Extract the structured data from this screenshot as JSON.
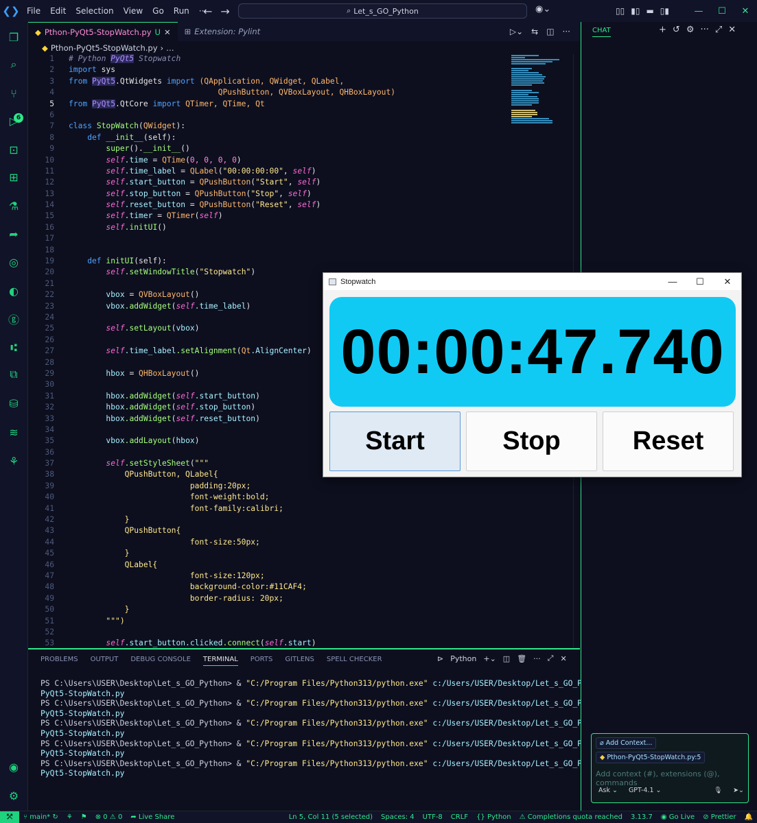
{
  "titlebar": {
    "menu": [
      "File",
      "Edit",
      "Selection",
      "View",
      "Go",
      "Run",
      "···"
    ],
    "search": "Let_s_GO_Python"
  },
  "scm_badge": "6",
  "tabs": [
    {
      "label": "Pthon-PyQt5-StopWatch.py",
      "flag": "U"
    },
    {
      "label": "Extension: Pylint"
    }
  ],
  "breadcrumb": {
    "file": "Pthon-PyQt5-StopWatch.py",
    "rest": "…"
  },
  "code_lines": [
    "1",
    "2",
    "3",
    "4",
    "5",
    "6",
    "7",
    "8",
    "9",
    "10",
    "11",
    "12",
    "13",
    "14",
    "15",
    "16",
    "17",
    "18",
    "19",
    "20",
    "21",
    "22",
    "23",
    "24",
    "25",
    "26",
    "27",
    "28",
    "29",
    "30",
    "31",
    "32",
    "33",
    "34",
    "35",
    "36",
    "37",
    "38",
    "39",
    "40",
    "41",
    "42",
    "43",
    "44",
    "45",
    "46",
    "47",
    "48",
    "49",
    "50",
    "51",
    "52",
    "53"
  ],
  "code": {
    "l1a": "# Python ",
    "l1b": "PyQt5",
    "l1c": " Stopwatch",
    "l2a": "import",
    "l2b": " sys",
    "l3a": "from ",
    "l3b": "PyQt5",
    "l3c": ".QtWidgets ",
    "l3d": "import ",
    "l3e": "(QApplication, QWidget, QLabel,",
    "l4": "                                QPushButton, QVBoxLayout, QHBoxLayout)",
    "l5a": "from ",
    "l5b": "PyQt5",
    "l5c": ".QtCore ",
    "l5d": "import ",
    "l5e": "QTimer, QTime, Qt",
    "l7a": "class ",
    "l7b": "StopWatch",
    "l7c": "(",
    "l7d": "QWidget",
    "l7e": "):",
    "l8a": "    def ",
    "l8b": "__init__",
    "l8c": "(self):",
    "l9a": "        super",
    "l9b": "().",
    "l9c": "__init__",
    "l9d": "()",
    "l10a": "self",
    ".l10b": "",
    "l10c": ".time = ",
    "l10d": "QTime",
    "l10e": "(",
    "l10f": "0, 0, 0, 0",
    "l10g": ")",
    "l11s": "\"00:00:00:00\"",
    "l12s": "\"Start\"",
    "l13s": "\"Stop\"",
    "l14s": "\"Reset\"",
    "l20s": "\"Stopwatch\"",
    "l37s": "\"\"\"",
    "l38": "QPushButton, QLabel{",
    "l39": "padding:20px;",
    "l40": "font-weight:bold;",
    "l41": "font-family:calibri;",
    "l42": "}",
    "l43": "QPushButton{",
    "l44": "font-size:50px;",
    "l45": "}",
    "l46": "QLabel{",
    "l47": "font-size:120px;",
    "l48": "background-color:#11CAF4;",
    "l49": "border-radius: 20px;",
    "l50": "}",
    "l51": "\"\"\")"
  },
  "panel": {
    "tabs": [
      "PROBLEMS",
      "OUTPUT",
      "DEBUG CONSOLE",
      "TERMINAL",
      "PORTS",
      "GITLENS",
      "SPELL CHECKER"
    ],
    "active_tab": "TERMINAL",
    "shell": "Python",
    "terminal_prompt": "PS C:\\Users\\USER\\Desktop\\Let_s_GO_Python> ",
    "terminal_cmd_amp": "& ",
    "terminal_exe": "\"C:/Program Files/Python313/python.exe\"",
    "terminal_arg": " c:/Users/USER/Desktop/Let_s_GO_Python/Pthon-",
    "terminal_wrap": "PyQt5-StopWatch.py"
  },
  "chat": {
    "title": "CHAT",
    "add_context": "Add Context...",
    "file_chip": "Pthon-PyQt5-StopWatch.py:5",
    "placeholder": "Add context (#), extensions (@), commands",
    "mode": "Ask",
    "model": "GPT-4.1"
  },
  "status": {
    "branch": "main*",
    "errors": "0",
    "warnings": "0",
    "live_share": "Live Share",
    "position": "Ln 5, Col 11 (5 selected)",
    "spaces": "Spaces: 4",
    "encoding": "UTF-8",
    "eol": "CRLF",
    "language": "Python",
    "quota": "Completions quota reached",
    "py_version": "3.13.7",
    "go_live": "Go Live",
    "prettier": "Prettier"
  },
  "stopwatch": {
    "title": "Stopwatch",
    "time": "00:00:47.740",
    "start": "Start",
    "stop": "Stop",
    "reset": "Reset",
    "time_bg": "#11caf4"
  }
}
